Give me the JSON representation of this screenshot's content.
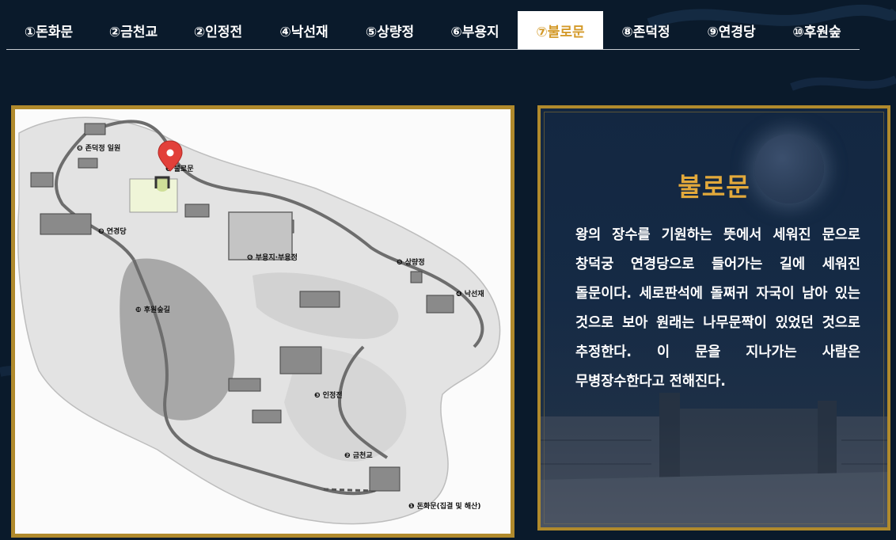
{
  "tabs": [
    {
      "label": "①돈화문",
      "active": false
    },
    {
      "label": "②금천교",
      "active": false
    },
    {
      "label": "②인정전",
      "active": false
    },
    {
      "label": "④낙선재",
      "active": false
    },
    {
      "label": "⑤상량정",
      "active": false
    },
    {
      "label": "⑥부용지",
      "active": false
    },
    {
      "label": "⑦불로문",
      "active": true
    },
    {
      "label": "⑧존덕정",
      "active": false
    },
    {
      "label": "⑨연경당",
      "active": false
    },
    {
      "label": "⑩후원숲",
      "active": false
    }
  ],
  "map": {
    "labels": {
      "l1": "❶ 돈화문(집결 및 해산)",
      "l2": "❷ 금천교",
      "l3": "❸ 인정전",
      "l4": "❹ 낙선재",
      "l5": "❺ 상량정",
      "l6": "❻ 부용지·부용정",
      "l7": "❼ 불로문",
      "l8": "❽ 존덕정 일원",
      "l9": "❾ 연경당",
      "l10": "❿ 후원숲길"
    },
    "marker_color": "#e2403a"
  },
  "info": {
    "title": "불로문",
    "text": "왕의 장수를 기원하는 뜻에서 세워진 문으로 창덕궁 연경당으로 들어가는 길에 세워진 돌문이다. 세로판석에 돌쩌귀 자국이 남아 있는 것으로 보아 원래는 나무문짝이 있었던 것으로 추정한다. 이 문을 지나가는 사람은 무병장수한다고 전해진다."
  },
  "colors": {
    "background": "#0a1a2b",
    "accent_gold": "#b08a2c",
    "title_gold": "#e2a93b",
    "active_tab_text": "#d49a2a"
  }
}
